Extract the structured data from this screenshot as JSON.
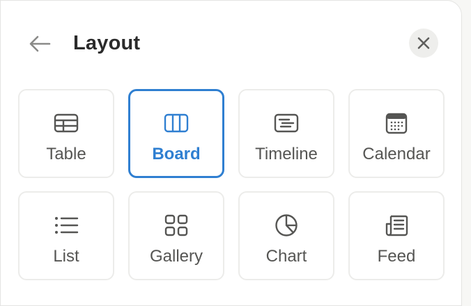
{
  "header": {
    "title": "Layout",
    "back_icon": "arrow-left-icon",
    "close_icon": "close-icon"
  },
  "colors": {
    "accent": "#2f7fd1",
    "text": "#2b2b2b",
    "muted": "#555553",
    "border": "#ececea"
  },
  "layouts": [
    {
      "label": "Table",
      "icon": "table-icon",
      "selected": false
    },
    {
      "label": "Board",
      "icon": "board-icon",
      "selected": true
    },
    {
      "label": "Timeline",
      "icon": "timeline-icon",
      "selected": false
    },
    {
      "label": "Calendar",
      "icon": "calendar-icon",
      "selected": false
    },
    {
      "label": "List",
      "icon": "list-icon",
      "selected": false
    },
    {
      "label": "Gallery",
      "icon": "gallery-icon",
      "selected": false
    },
    {
      "label": "Chart",
      "icon": "chart-icon",
      "selected": false
    },
    {
      "label": "Feed",
      "icon": "feed-icon",
      "selected": false
    }
  ]
}
